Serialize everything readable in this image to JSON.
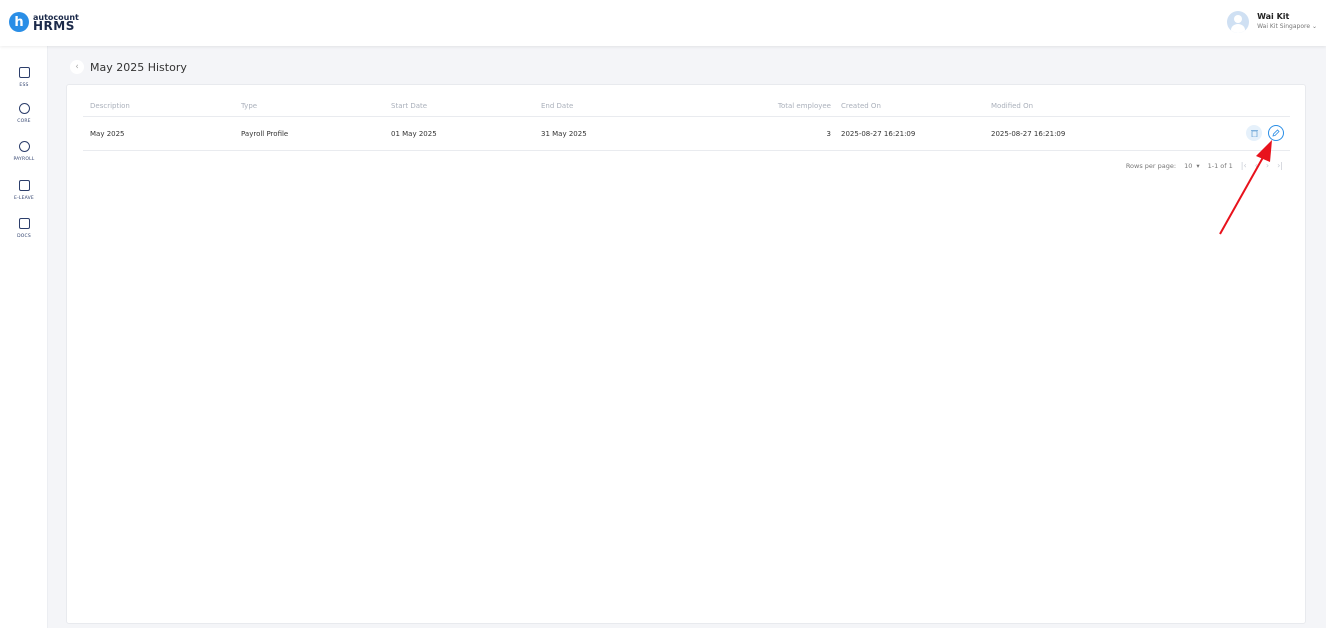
{
  "header": {
    "logo_small": "autocount",
    "logo_big": "HRMS",
    "user_name": "Wai Kit",
    "user_company": "Wai Kit Singapore"
  },
  "sidebar": {
    "items": [
      {
        "label": "ESS",
        "icon": "person-card-icon"
      },
      {
        "label": "CORE",
        "icon": "cube-icon"
      },
      {
        "label": "PAYROLL",
        "icon": "dollar-icon"
      },
      {
        "label": "E-LEAVE",
        "icon": "calendar-icon"
      },
      {
        "label": "DOCS",
        "icon": "document-chart-icon"
      }
    ]
  },
  "page": {
    "title": "May 2025 History"
  },
  "table": {
    "headers": {
      "description": "Description",
      "type": "Type",
      "start_date": "Start Date",
      "end_date": "End Date",
      "total_employee": "Total employee",
      "created_on": "Created On",
      "modified_on": "Modified On"
    },
    "rows": [
      {
        "description": "May 2025",
        "type": "Payroll Profile",
        "start_date": "01 May 2025",
        "end_date": "31 May 2025",
        "total_employee": "3",
        "created_on": "2025-08-27 16:21:09",
        "modified_on": "2025-08-27 16:21:09"
      }
    ]
  },
  "pagination": {
    "rows_per_page_label": "Rows per page:",
    "rows_per_page_value": "10",
    "range": "1-1 of 1"
  },
  "colors": {
    "accent": "#2a8ee6",
    "annotation_arrow": "#e8121c"
  }
}
